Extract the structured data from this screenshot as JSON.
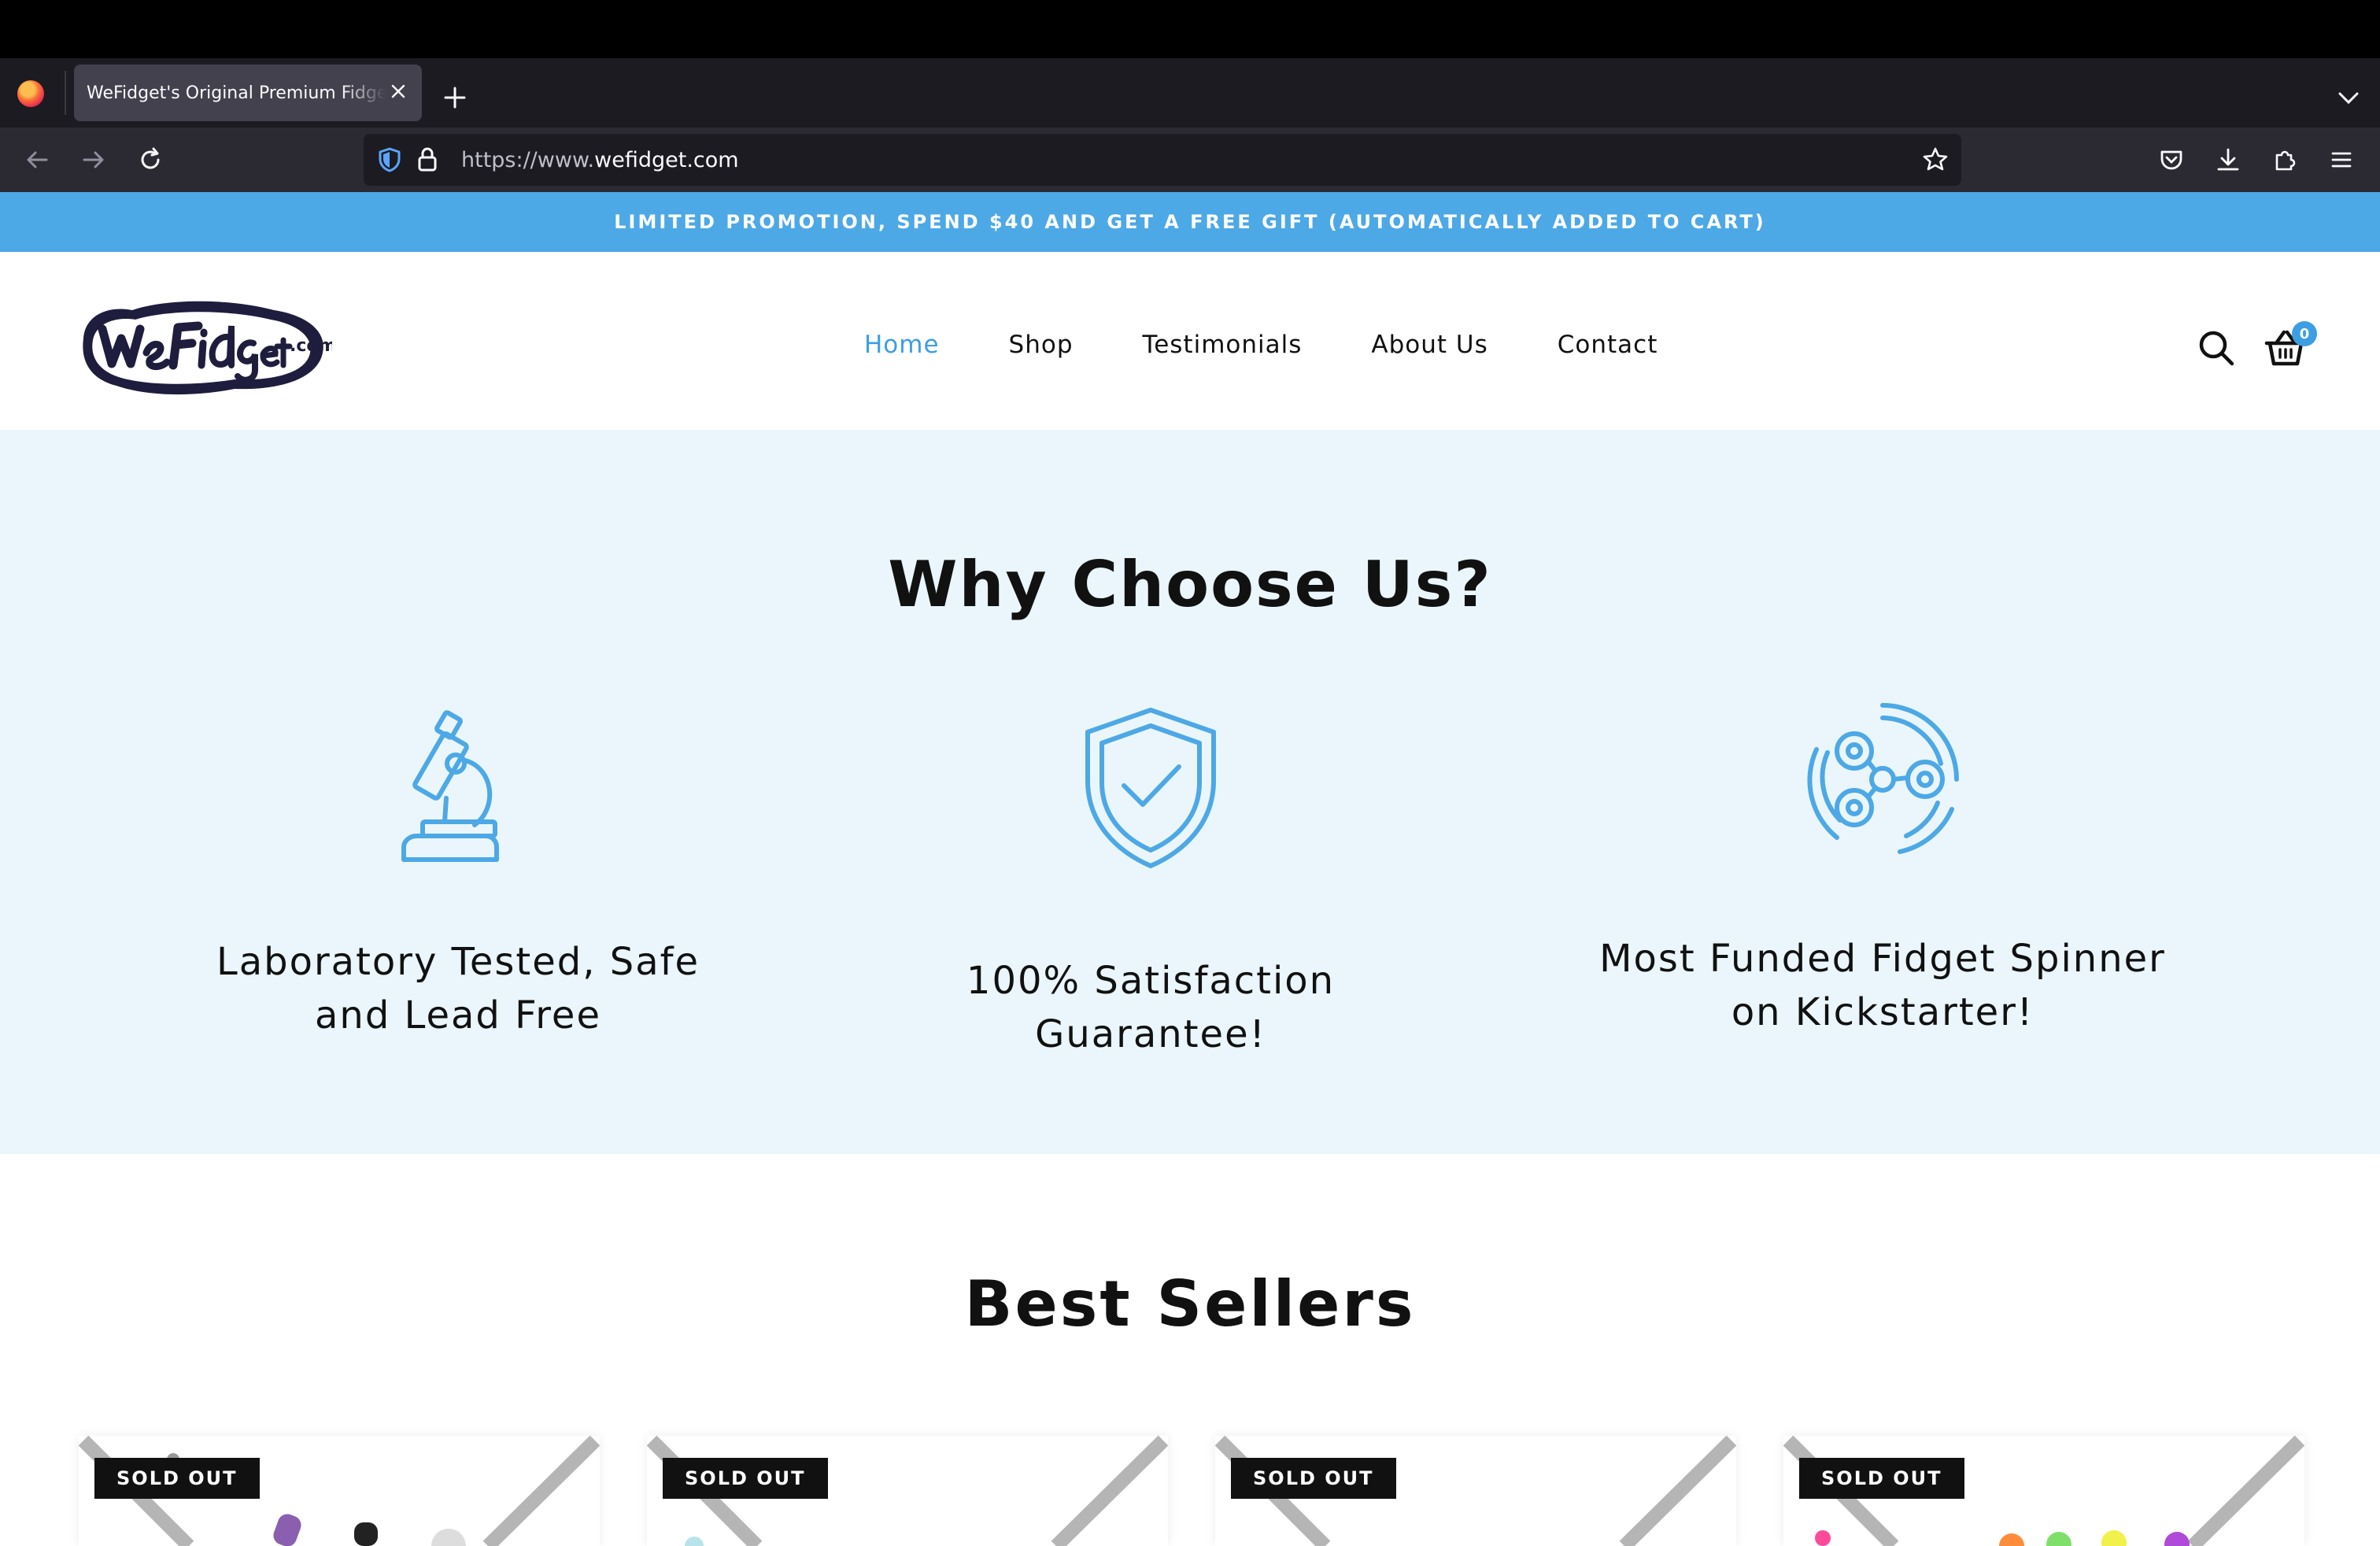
{
  "browser": {
    "tab_title": "WeFidget's Original Premium Fidget Spinners",
    "url_prefix": "https://www.",
    "url_domain": "wefidget.com"
  },
  "promo": {
    "text": "LIMITED PROMOTION, SPEND $40 AND GET A FREE GIFT (AUTOMATICALLY ADDED TO CART)",
    "background": "#4da8e6"
  },
  "header": {
    "logo_alt": "WeFidget.com",
    "menu": [
      {
        "label": "Home",
        "active": true
      },
      {
        "label": "Shop",
        "active": false
      },
      {
        "label": "Testimonials",
        "active": false
      },
      {
        "label": "About Us",
        "active": false
      },
      {
        "label": "Contact",
        "active": false
      }
    ],
    "cart_count": "0",
    "accent": "#3d9ee3"
  },
  "why": {
    "title": "Why Choose Us?",
    "features": [
      {
        "icon": "microscope-icon",
        "text_line1": "Laboratory Tested, Safe",
        "text_line2": "and Lead Free"
      },
      {
        "icon": "shield-check-icon",
        "text_line1": "100% Satisfaction",
        "text_line2": "Guarantee!"
      },
      {
        "icon": "fidget-spinner-icon",
        "text_line1": "Most Funded Fidget Spinner",
        "text_line2": "on Kickstarter!"
      }
    ],
    "background": "#eaf6fb"
  },
  "best_sellers": {
    "title": "Best Sellers",
    "badge": "SOLD OUT"
  }
}
